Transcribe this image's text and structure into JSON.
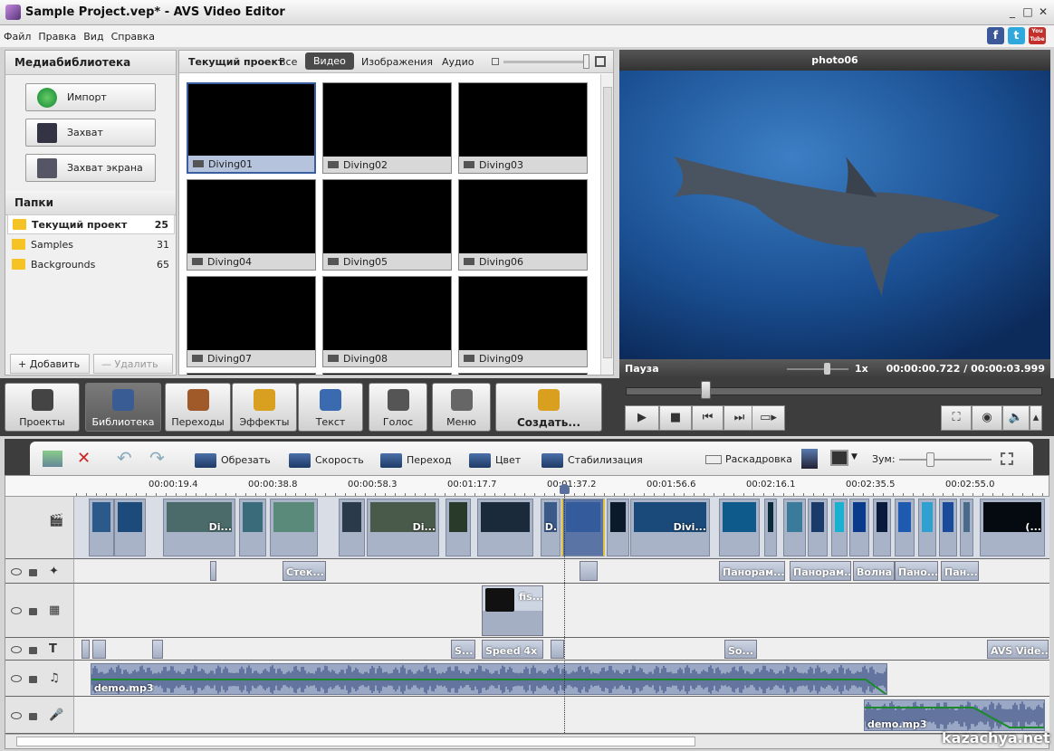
{
  "window": {
    "title": "Sample Project.vep* - AVS Video Editor"
  },
  "menu": [
    "Файл",
    "Правка",
    "Вид",
    "Справка"
  ],
  "social": [
    "f",
    "t",
    "You Tube"
  ],
  "library": {
    "title": "Медиабиблиотека",
    "buttons": [
      "Импорт",
      "Захват",
      "Захват экрана"
    ],
    "folders_title": "Папки",
    "folders": [
      {
        "name": "Текущий проект",
        "count": "25"
      },
      {
        "name": "Samples",
        "count": "31"
      },
      {
        "name": "Backgrounds",
        "count": "65"
      }
    ],
    "add": "+ Добавить",
    "remove": "— Удалить"
  },
  "media": {
    "title": "Текущий проект",
    "tabs": [
      "Все",
      "Видео",
      "Изображения",
      "Аудио"
    ],
    "active_tab": "Видео",
    "items": [
      "Diving01",
      "Diving02",
      "Diving03",
      "Diving04",
      "Diving05",
      "Diving06",
      "Diving07",
      "Diving08",
      "Diving09"
    ],
    "selected": "Diving01"
  },
  "preview": {
    "title": "photo06",
    "status": "Пауза",
    "speed": "1x",
    "time": "00:00:00.722 / 00:00:03.999",
    "progress": 0.18
  },
  "mainbar": [
    "Проекты",
    "Библиотека",
    "Переходы",
    "Эффекты",
    "Текст",
    "Голос",
    "Меню",
    "Создать..."
  ],
  "mainbar_active": "Библиотека",
  "player_buttons": [
    "play",
    "stop",
    "previous",
    "next",
    "video-fx",
    "fullscreen",
    "snapshot",
    "volume",
    "more"
  ],
  "timeline_tools": {
    "items": [
      "Обрезать",
      "Скорость",
      "Переход",
      "Цвет",
      "Стабилизация"
    ],
    "storyboard": "Раскадровка",
    "zoom": "Зум:"
  },
  "ruler": [
    "00:00:19.4",
    "00:00:38.8",
    "00:00:58.3",
    "00:01:17.7",
    "00:01:37.2",
    "00:01:56.6",
    "00:02:16.1",
    "00:02:35.5",
    "00:02:55.0"
  ],
  "tracks": {
    "video_labels": [
      "Di...",
      "Di...",
      "D.",
      "Divi...",
      "(..."
    ],
    "effects": [
      "Стек...",
      "Панорам...",
      "Панорам...",
      "Волна",
      "Пано...",
      "Пан..."
    ],
    "overlay": [
      "fis..."
    ],
    "text": [
      "S...",
      "Speed 4x",
      "So...",
      "AVS Vide..."
    ],
    "audio": "demo.mp3",
    "voice": "demo.mp3"
  },
  "watermark": "kazachya.net"
}
